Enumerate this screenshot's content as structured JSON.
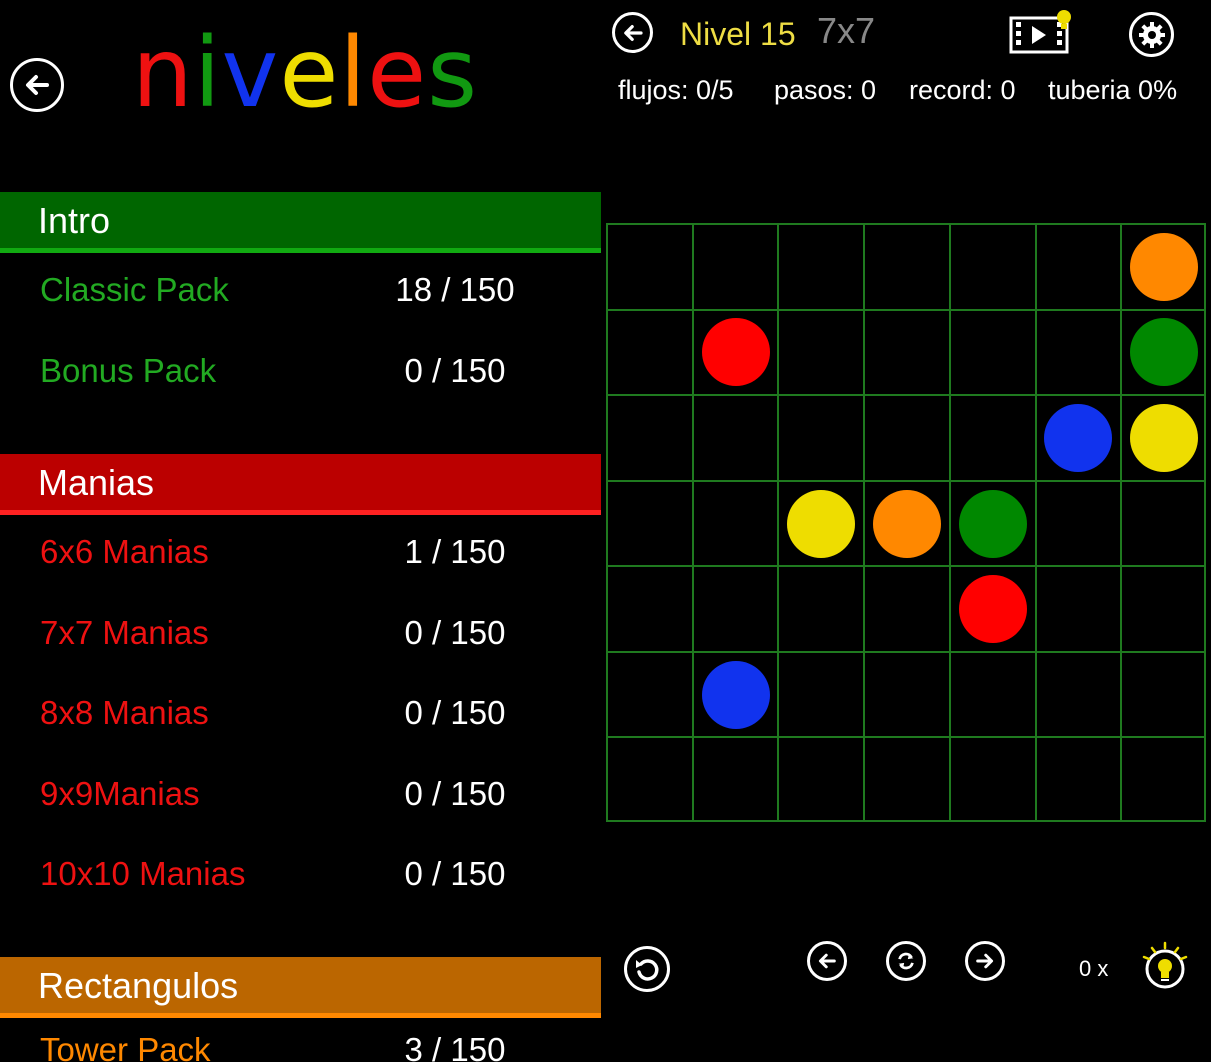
{
  "levels": {
    "title_letters": [
      {
        "ch": "n",
        "color": "#ee1111"
      },
      {
        "ch": "i",
        "color": "#119911"
      },
      {
        "ch": "v",
        "color": "#1133ee"
      },
      {
        "ch": "e",
        "color": "#eedd00"
      },
      {
        "ch": "l",
        "color": "#ff8800"
      },
      {
        "ch": "e",
        "color": "#ee1111"
      },
      {
        "ch": "s",
        "color": "#119911"
      }
    ],
    "sections": [
      {
        "label": "Intro",
        "bg": "#006600",
        "border": "#11aa11",
        "text_color": "#22aa22",
        "packs": [
          {
            "name": "Classic Pack",
            "count": "18 / 150"
          },
          {
            "name": "Bonus Pack",
            "count": "0 / 150"
          }
        ]
      },
      {
        "label": "Manias",
        "bg": "#bb0000",
        "border": "#ff2222",
        "text_color": "#ee1111",
        "packs": [
          {
            "name": "6x6 Manias",
            "count": "1 / 150"
          },
          {
            "name": "7x7 Manias",
            "count": "0 / 150"
          },
          {
            "name": "8x8 Manias",
            "count": "0 / 150"
          },
          {
            "name": "9x9Manias",
            "count": "0 / 150"
          },
          {
            "name": "10x10 Manias",
            "count": "0 / 150"
          }
        ]
      },
      {
        "label": "Rectangulos",
        "bg": "#bb6600",
        "border": "#ff8800",
        "text_color": "#ff8800",
        "packs": [
          {
            "name": "Tower Pack",
            "count": "3 / 150"
          }
        ]
      }
    ],
    "icons": {
      "back": "back-arrow-icon"
    }
  },
  "game": {
    "level_label": "Nivel 15",
    "size_label": "7x7",
    "level_color": "#eedd44",
    "size_color": "#888888",
    "stats": {
      "flows": "flujos: 0/5",
      "moves": "pasos: 0",
      "record": "record: 0",
      "pipe": "tuberia 0%"
    },
    "hint_count": "0 x",
    "grid_color": "#1f7a1f",
    "board": {
      "rows": 7,
      "cols": 7,
      "dots": [
        {
          "row": 0,
          "col": 6,
          "color": "#ff8800"
        },
        {
          "row": 1,
          "col": 1,
          "color": "#ff0000"
        },
        {
          "row": 1,
          "col": 6,
          "color": "#008800"
        },
        {
          "row": 2,
          "col": 5,
          "color": "#1133ee"
        },
        {
          "row": 2,
          "col": 6,
          "color": "#eedd00"
        },
        {
          "row": 3,
          "col": 2,
          "color": "#eedd00"
        },
        {
          "row": 3,
          "col": 3,
          "color": "#ff8800"
        },
        {
          "row": 3,
          "col": 4,
          "color": "#008800"
        },
        {
          "row": 4,
          "col": 4,
          "color": "#ff0000"
        },
        {
          "row": 5,
          "col": 1,
          "color": "#1133ee"
        }
      ]
    },
    "icons": [
      "back-arrow-icon",
      "video-hint-icon",
      "gear-icon",
      "undo-icon",
      "prev-level-icon",
      "restart-icon",
      "next-level-icon",
      "lightbulb-icon"
    ]
  }
}
